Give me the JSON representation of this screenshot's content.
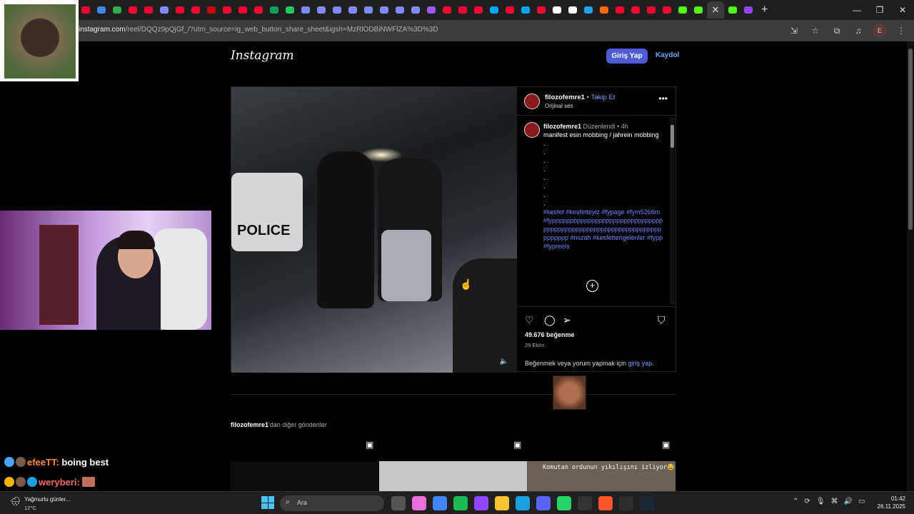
{
  "browser": {
    "url_host": "instagram.com",
    "url_rest": "/reel/DQQz9pQjGf_/?utm_source=ig_web_button_share_sheet&igsh=MzRlODBiNWFlZA%3D%3D",
    "profile_initial": "E",
    "tab_colors": [
      "#ff0033",
      "#4285f4",
      "#34a853",
      "#ff0033",
      "#ff0033",
      "#7b8cff",
      "#ff0033",
      "#ff0033",
      "#cc0000",
      "#ff0033",
      "#ff0033",
      "#ff0033",
      "#0f9d58",
      "#22c55e",
      "#7b8cff",
      "#7b8cff",
      "#7b8cff",
      "#7b8cff",
      "#7b8cff",
      "#7b8cff",
      "#7b8cff",
      "#7b8cff",
      "#9b5cff",
      "#ff0033",
      "#ff0033",
      "#ff0033",
      "#00a4ef",
      "#ff0033",
      "#00a4ef",
      "#ff0033",
      "#ffffff",
      "#ffffff",
      "#1da1f2",
      "#ff6a00",
      "#ff0033",
      "#ff0033",
      "#ff0033",
      "#ff0033",
      "#53fc18",
      "#53fc18",
      "#53fc18",
      "#9146ff"
    ],
    "active_tab_close": "✕",
    "new_tab": "+",
    "window_controls": [
      "—",
      "❐",
      "✕"
    ]
  },
  "instagram": {
    "logo": "Instagram",
    "login_label": "Giriş Yap",
    "signup_label": "Kaydol",
    "post": {
      "username": "filozofemre1",
      "separator": "•",
      "follow_label": "Takip Et",
      "audio": "Orijinal ses",
      "caption_edited": "Düzenlendi",
      "caption_time": "4h",
      "caption_text": "manifest esin mobbing / jahrein mobbing",
      "caption_dots": ".\n.\n.\n.\n.\n.\n.\n.",
      "hashtags": "#kesfet #kesfetteyiz #fypage #fym5266m #fyppppppppppppppppppppppppppppppppppppppppppppppppppppppppppppppppppppppp #mizah #kesfettengelenler #fypp #fypreels",
      "police_text": "POLICE",
      "likes": "49.676 beğenme",
      "date": "25 Ekim",
      "login_prompt": "Beğenmek veya yorum yapmak için",
      "login_link": "giriş yap",
      "login_suffix": "."
    },
    "more_posts": {
      "username": "filozofemre1",
      "suffix": "'dan diğer gönderiler",
      "thumb3_text": "Komutan ordunun yıkılışını izliyor😂"
    }
  },
  "chat": [
    {
      "user": "efeeTT:",
      "message": "boing best"
    },
    {
      "user": "weryberi:",
      "message": ""
    }
  ],
  "taskbar": {
    "weather_line1": "Yağmurlu günler...",
    "weather_line2": "12°C",
    "search_placeholder": "Ara",
    "time": "01:42",
    "date": "26.11.2025",
    "app_colors": [
      "#555555",
      "#e86fd8",
      "#4285f4",
      "#1db954",
      "#9146ff",
      "#f4c430",
      "#1ba1e2",
      "#5865f2",
      "#25d366",
      "#333333",
      "#fb542b",
      "#2d2d2d",
      "#1b2838"
    ]
  }
}
